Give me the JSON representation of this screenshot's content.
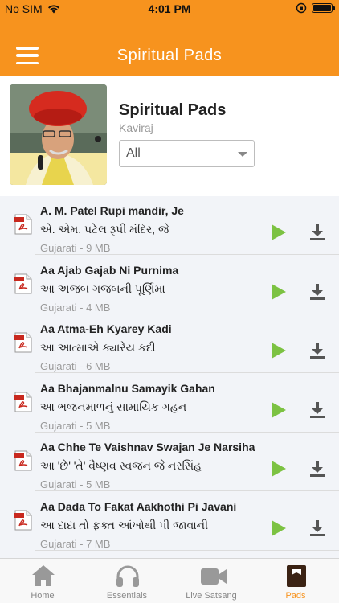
{
  "status": {
    "carrier": "No SIM",
    "time": "4:01 PM"
  },
  "nav": {
    "title": "Spiritual Pads"
  },
  "header": {
    "title": "Spiritual Pads",
    "author": "Kaviraj",
    "filter_value": "All"
  },
  "items": [
    {
      "title": "A. M. Patel Rupi mandir, Je",
      "subtitle": "એ. એમ. પટેલ રૂપી મંદિર, જે",
      "meta": "Gujarati - 9 MB"
    },
    {
      "title": "Aa Ajab Gajab Ni Purnima",
      "subtitle": "આ અજબ ગજબની પૂર્ણિમા",
      "meta": "Gujarati - 4 MB"
    },
    {
      "title": "Aa Atma-Eh Kyarey Kadi",
      "subtitle": "આ આત્માએ ક્યારેય કદી",
      "meta": "Gujarati - 6 MB"
    },
    {
      "title": "Aa Bhajanmalnu Samayik Gahan",
      "subtitle": "આ ભજનમાળનું સામાયિક ગહન",
      "meta": "Gujarati - 5 MB"
    },
    {
      "title": "Aa Chhe Te Vaishnav Swajan Je Narsiha",
      "subtitle": "આ 'છે' 'તે' વૈષ્ણવ સ્વજન જે નરસિંહ",
      "meta": "Gujarati - 5 MB"
    },
    {
      "title": "Aa Dada To Fakat Aakhothi Pi Javani",
      "subtitle": "આ દાદા તો ફક્ત આંખોથી પી જાવાની",
      "meta": "Gujarati - 7 MB"
    }
  ],
  "tabs": [
    {
      "label": "Home",
      "icon": "home-icon"
    },
    {
      "label": "Essentials",
      "icon": "headphones-icon"
    },
    {
      "label": "Live Satsang",
      "icon": "video-camera-icon"
    },
    {
      "label": "Pads",
      "icon": "book-icon",
      "active": true
    }
  ],
  "colors": {
    "accent": "#f7931e",
    "play": "#7cc242",
    "list_bg": "#f2f4f8"
  }
}
